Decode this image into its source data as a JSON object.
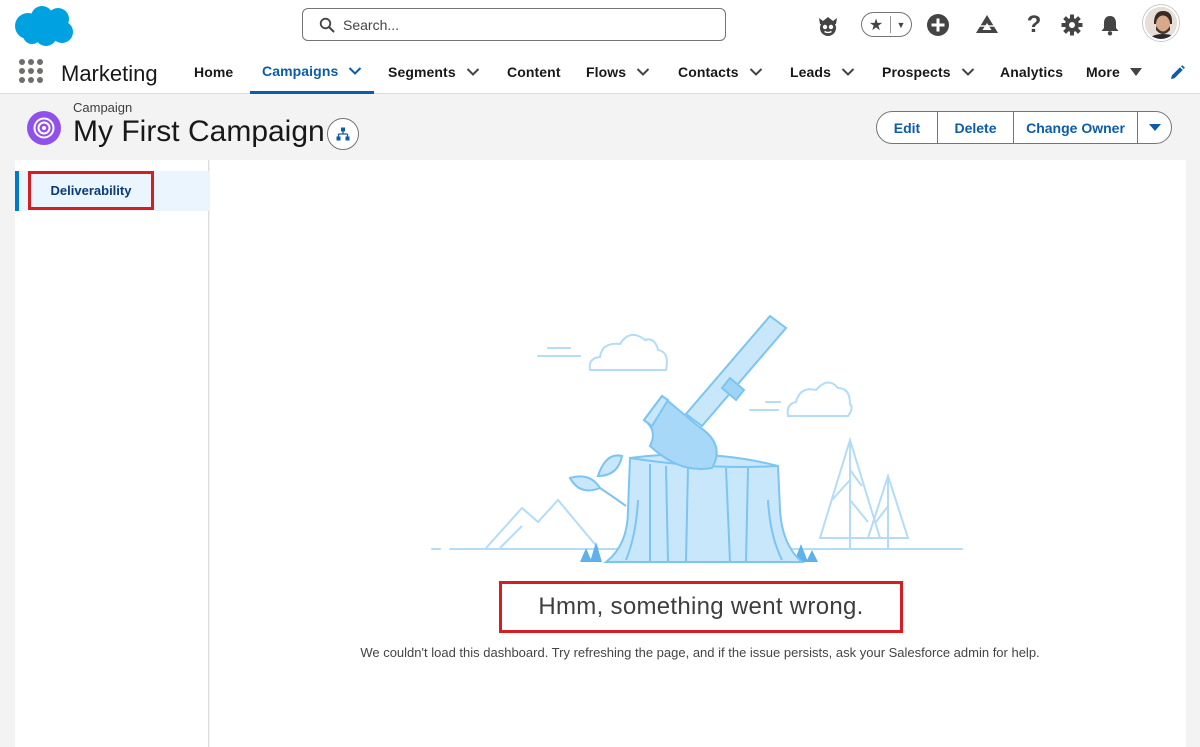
{
  "header": {
    "search_placeholder": "Search..."
  },
  "nav": {
    "app_name": "Marketing",
    "items": [
      {
        "label": "Home"
      },
      {
        "label": "Campaigns"
      },
      {
        "label": "Segments"
      },
      {
        "label": "Content"
      },
      {
        "label": "Flows"
      },
      {
        "label": "Contacts"
      },
      {
        "label": "Leads"
      },
      {
        "label": "Prospects"
      },
      {
        "label": "Analytics"
      },
      {
        "label": "More"
      }
    ],
    "active_item": "Campaigns"
  },
  "record": {
    "type": "Campaign",
    "title": "My First Campaign",
    "actions": {
      "edit": "Edit",
      "delete": "Delete",
      "change_owner": "Change Owner"
    }
  },
  "sidebar": {
    "items": [
      {
        "label": "Deliverability",
        "selected": true
      }
    ]
  },
  "error": {
    "title": "Hmm, something went wrong.",
    "message": "We couldn't load this dashboard. Try refreshing the page, and if the issue persists, ask your Salesforce admin for help."
  },
  "colors": {
    "brand_blue": "#0b5cab",
    "salesforce_cloud": "#00a1e0",
    "campaign_icon": "#9050e9",
    "highlight_red": "#d81c23",
    "illustration_light": "#c9e7fb",
    "illustration_line": "#7cc4f2"
  },
  "icons": [
    "salesforce-logo-icon",
    "search-icon",
    "einstein-icon",
    "star-icon",
    "plus-icon",
    "trailhead-icon",
    "help-icon",
    "gear-icon",
    "bell-icon",
    "waffle-icon",
    "chevron-down-icon",
    "pencil-icon",
    "campaign-target-icon",
    "hierarchy-icon"
  ]
}
